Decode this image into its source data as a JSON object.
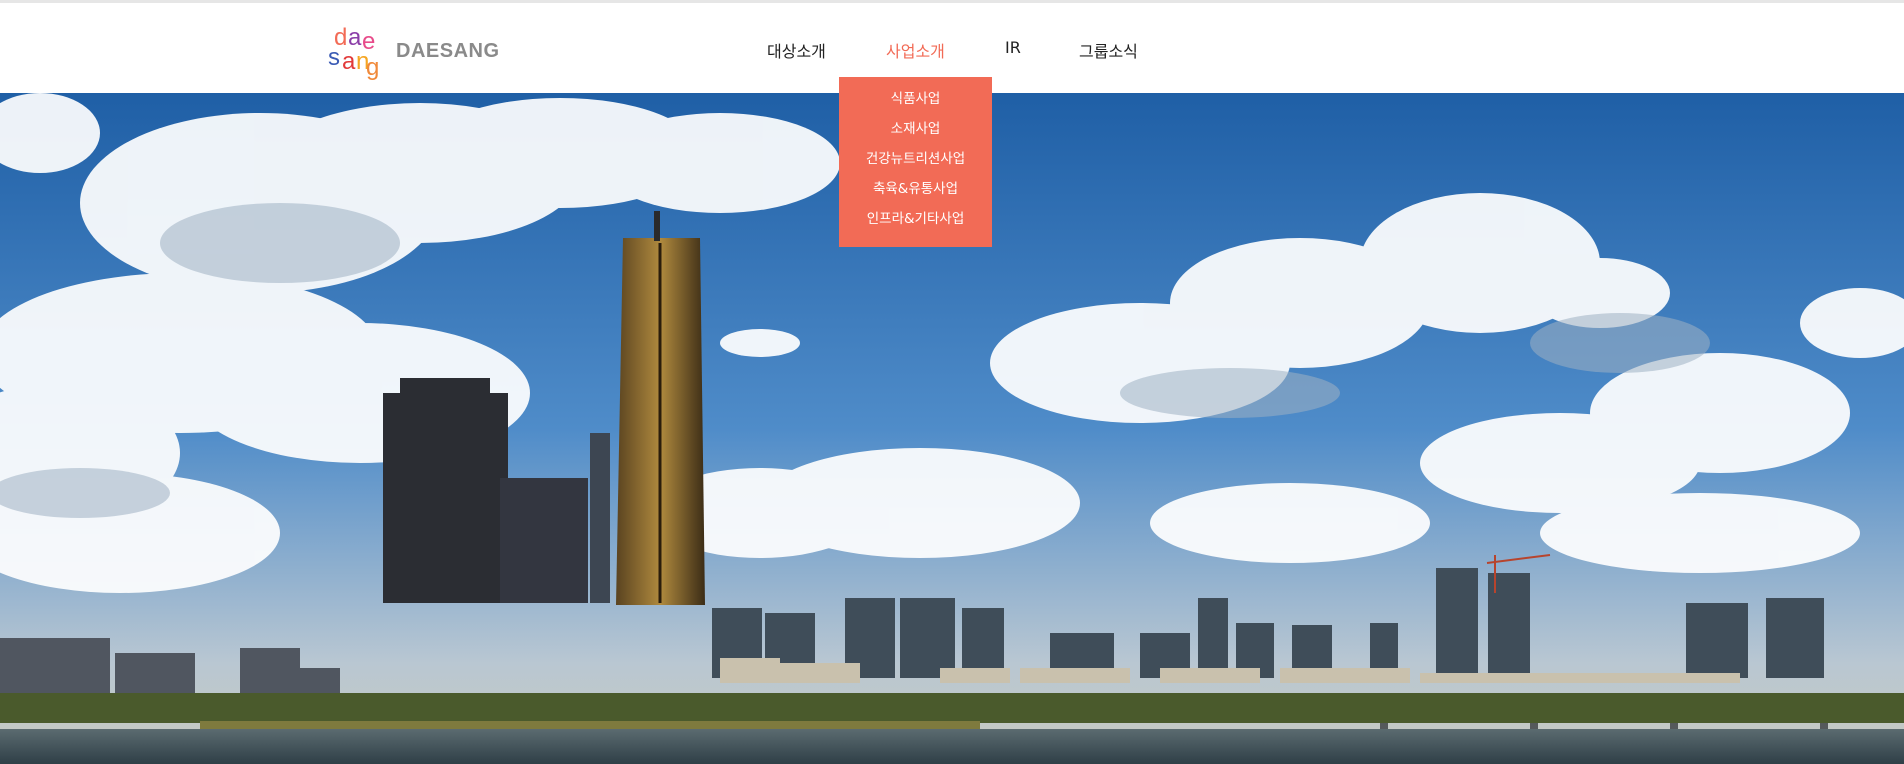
{
  "brand": {
    "logo_text": "DAESANG",
    "logo_glyphs": [
      "d",
      "a",
      "e",
      "s",
      "a",
      "n",
      "g"
    ]
  },
  "nav": {
    "items": [
      {
        "label": "대상소개",
        "active": false
      },
      {
        "label": "사업소개",
        "active": true
      },
      {
        "label": "IR",
        "active": false
      },
      {
        "label": "그룹소식",
        "active": false
      }
    ]
  },
  "dropdown": {
    "items": [
      {
        "label": "식품사업"
      },
      {
        "label": "소재사업"
      },
      {
        "label": "건강뉴트리션사업"
      },
      {
        "label": "축육&유통사업"
      },
      {
        "label": "인프라&기타사업"
      }
    ]
  },
  "colors": {
    "accent": "#f26b56",
    "nav_text": "#222222",
    "logo_text": "#8a8a8a",
    "sky_top": "#1f5fa6",
    "river": "#4a5c66"
  },
  "hero": {
    "image": "seoul-skyline-han-river-photo"
  }
}
